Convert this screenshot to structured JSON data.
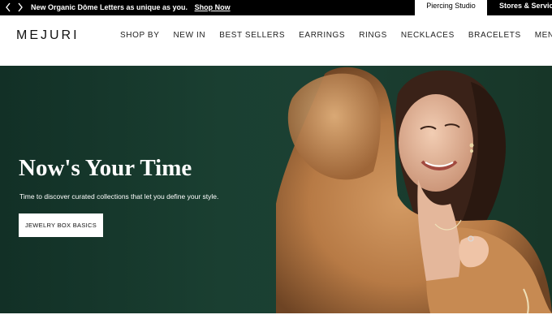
{
  "announcement": {
    "text": "New Organic Dôme Letters as unique as you.",
    "link_label": "Shop Now"
  },
  "utility_tabs": {
    "piercing": "Piercing Studio",
    "stores": "Stores & Services"
  },
  "header": {
    "logo": "MEJURI",
    "nav": [
      "SHOP BY",
      "NEW IN",
      "BEST SELLERS",
      "EARRINGS",
      "RINGS",
      "NECKLACES",
      "BRACELETS",
      "MEN'S"
    ]
  },
  "hero": {
    "title": "Now's Your Time",
    "subtitle": "Time to discover curated collections that let you define your style.",
    "cta_label": "JEWELRY BOX BASICS"
  },
  "icons": {
    "prev": "chevron-left-icon",
    "next": "chevron-right-icon"
  },
  "colors": {
    "topbar": "#000000",
    "hero_background": "#16382b",
    "fur": "#b77a45"
  }
}
